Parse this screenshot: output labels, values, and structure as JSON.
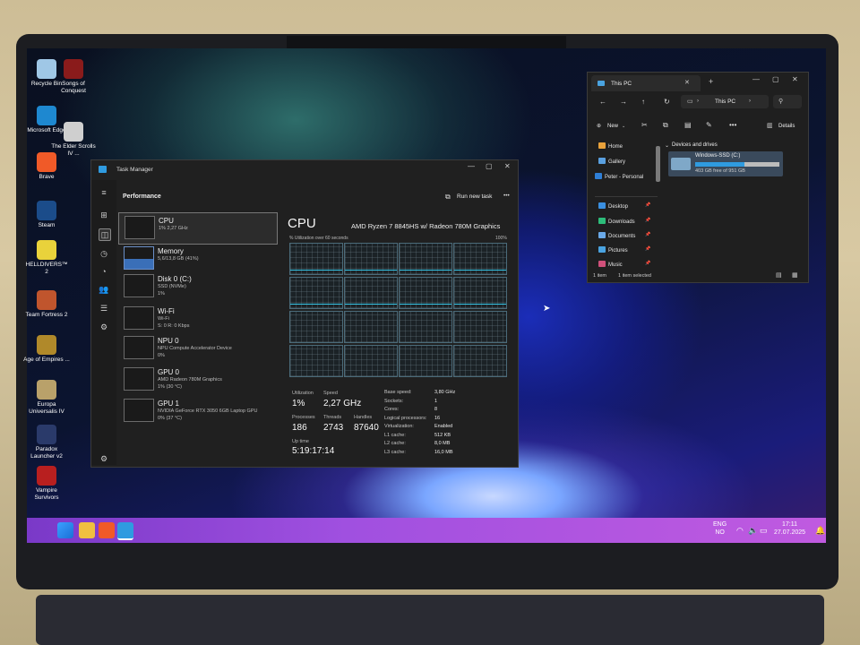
{
  "desktop": {
    "icons": [
      {
        "label": "Recycle Bin",
        "color": "#9fc7e6"
      },
      {
        "label": "Songs of Conquest",
        "color": "#8a1b1b"
      },
      {
        "label": "Microsoft Edge",
        "color": "#1e88d0"
      },
      {
        "label": "The Elder Scrolls IV ...",
        "color": "#cfcfcf"
      },
      {
        "label": "Brave",
        "color": "#f05a28"
      },
      {
        "label": "Steam",
        "color": "#1b4c8a"
      },
      {
        "label": "HELLDIVERS™ 2",
        "color": "#e9d23b"
      },
      {
        "label": "Team Fortress 2",
        "color": "#c0552d"
      },
      {
        "label": "Age of Empires ...",
        "color": "#b0892a"
      },
      {
        "label": "Europa Universalis IV",
        "color": "#b9a16a"
      },
      {
        "label": "Paradox Launcher v2",
        "color": "#2a3a6a"
      },
      {
        "label": "Vampire Survivors",
        "color": "#b81f1f"
      }
    ]
  },
  "task_manager": {
    "title": "Task Manager",
    "section": "Performance",
    "run_new_task": "Run new task",
    "more": "•••",
    "items": [
      {
        "name": "CPU",
        "sub": "1% 2,27 GHz"
      },
      {
        "name": "Memory",
        "sub": "5,6/13,8 GB (41%)"
      },
      {
        "name": "Disk 0 (C:)",
        "sub": "SSD (NVMe)",
        "sub2": "1%"
      },
      {
        "name": "Wi-Fi",
        "sub": "Wi-Fi",
        "sub2": "S: 0 R: 0 Kbps"
      },
      {
        "name": "NPU 0",
        "sub": "NPU Compute Accelerator Device",
        "sub2": "0%"
      },
      {
        "name": "GPU 0",
        "sub": "AMD Radeon 780M Graphics",
        "sub2": "1% (30 °C)"
      },
      {
        "name": "GPU 1",
        "sub": "NVIDIA GeForce RTX 3050 6GB Laptop GPU",
        "sub2": "0% (37 °C)"
      }
    ],
    "detail": {
      "heading": "CPU",
      "model": "AMD Ryzen 7 8845HS w/ Radeon 780M Graphics",
      "graph_caption": "% Utilization over 60 seconds",
      "graph_max": "100%",
      "utilization_label": "Utilization",
      "utilization": "1%",
      "speed_label": "Speed",
      "speed": "2,27 GHz",
      "processes_label": "Processes",
      "processes": "186",
      "threads_label": "Threads",
      "threads": "2743",
      "handles_label": "Handles",
      "handles": "87640",
      "uptime_label": "Up time",
      "uptime": "5:19:17:14",
      "specs": [
        {
          "k": "Base speed:",
          "v": "3,80 GHz"
        },
        {
          "k": "Sockets:",
          "v": "1"
        },
        {
          "k": "Cores:",
          "v": "8"
        },
        {
          "k": "Logical processors:",
          "v": "16"
        },
        {
          "k": "Virtualization:",
          "v": "Enabled"
        },
        {
          "k": "L1 cache:",
          "v": "512 KB"
        },
        {
          "k": "L2 cache:",
          "v": "8,0 MB"
        },
        {
          "k": "L3 cache:",
          "v": "16,0 MB"
        }
      ]
    }
  },
  "explorer": {
    "tab_title": "This PC",
    "address": "This PC",
    "new_label": "New",
    "details_label": "Details",
    "section": "Devices and drives",
    "drive_name": "Windows-SSD (C:)",
    "drive_free": "403 GB free of 951 GB",
    "drive_used_fraction": 0.58,
    "nav": [
      {
        "label": "Home",
        "color": "#e9a23b"
      },
      {
        "label": "Gallery",
        "color": "#5aa0e0"
      },
      {
        "label": "Peter - Personal",
        "color": "#2f7fd6"
      },
      {
        "label": "Desktop",
        "color": "#3a8fe0"
      },
      {
        "label": "Downloads",
        "color": "#2dbd7a"
      },
      {
        "label": "Documents",
        "color": "#6aa9e8"
      },
      {
        "label": "Pictures",
        "color": "#4aa3e0"
      },
      {
        "label": "Music",
        "color": "#d0507a"
      }
    ],
    "status_items": "1 item",
    "status_selected": "1 item selected"
  },
  "taskbar": {
    "lang": "ENG",
    "region": "NO",
    "time": "17:11",
    "date": "27.07.2025"
  },
  "colors": {
    "taskbar": "#a050e0",
    "accent": "#2f9be0"
  }
}
